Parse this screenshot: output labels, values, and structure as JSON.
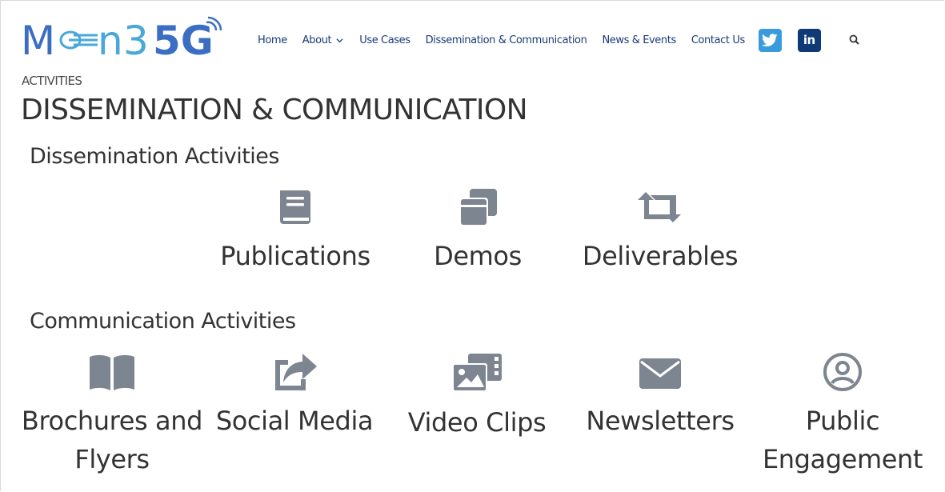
{
  "header": {
    "logo_text": "MoN3SG",
    "nav": [
      "Home",
      "About",
      "Use Cases",
      "Dissemination & Communication",
      "News & Events",
      "Contact Us"
    ],
    "social": {
      "twitter": "twitter-icon",
      "linkedin_text": "in"
    },
    "search_icon": "search-icon"
  },
  "breadcrumb": "ACTIVITIES",
  "page_title": "DISSEMINATION & COMMUNICATION",
  "sections": {
    "dissemination": {
      "title": "Dissemination Activities",
      "items": [
        {
          "label": "Publications",
          "icon": "book-icon"
        },
        {
          "label": "Demos",
          "icon": "clone-icon"
        },
        {
          "label": "Deliverables",
          "icon": "retweet-icon"
        }
      ]
    },
    "communication": {
      "title": "Communication Activities",
      "items": [
        {
          "label": "Brochures and Flyers",
          "icon": "open-book-icon"
        },
        {
          "label": "Social Media",
          "icon": "share-icon"
        },
        {
          "label": "Video Clips",
          "icon": "photo-video-icon"
        },
        {
          "label": "Newsletters",
          "icon": "envelope-icon"
        },
        {
          "label": "Public Engagement",
          "icon": "user-circle-icon"
        }
      ]
    }
  },
  "colors": {
    "nav": "#1b3a7a",
    "icon": "#7d8590",
    "logo_blue": "#3b6ec2",
    "logo_light": "#4aa8d8"
  }
}
